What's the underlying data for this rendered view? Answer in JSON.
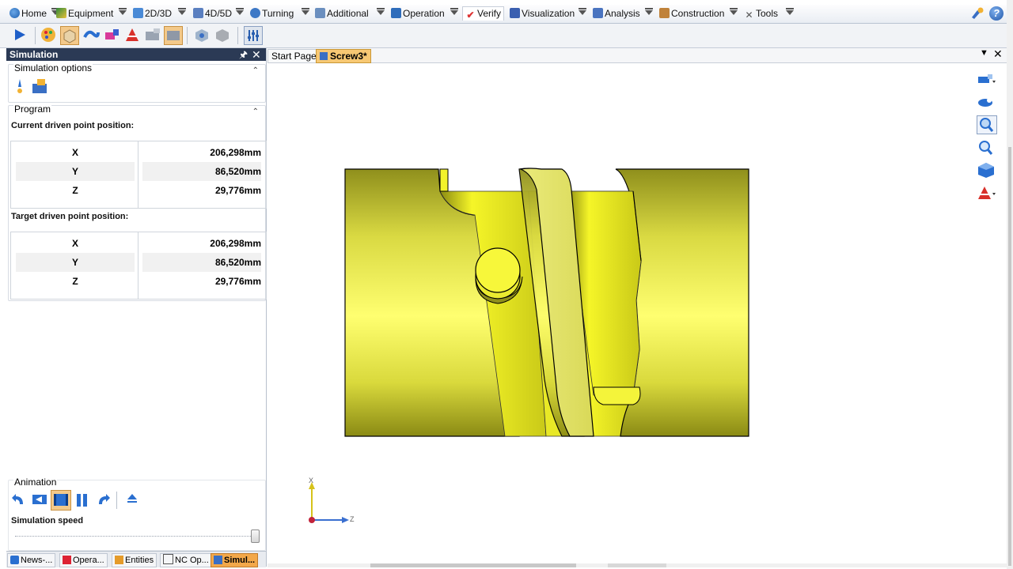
{
  "menu": {
    "items": [
      {
        "label": "Home",
        "icon": "home-icon"
      },
      {
        "label": "Equipment",
        "icon": "equipment-icon"
      },
      {
        "label": "2D/3D",
        "icon": "2d3d-icon"
      },
      {
        "label": "4D/5D",
        "icon": "4d5d-icon"
      },
      {
        "label": "Turning",
        "icon": "turning-icon"
      },
      {
        "label": "Additional",
        "icon": "additional-icon"
      },
      {
        "label": "Operation",
        "icon": "operation-icon"
      },
      {
        "label": "Verify",
        "icon": "verify-icon",
        "active": true
      },
      {
        "label": "Visualization",
        "icon": "visualization-icon"
      },
      {
        "label": "Analysis",
        "icon": "analysis-icon"
      },
      {
        "label": "Construction",
        "icon": "construction-icon"
      },
      {
        "label": "Tools",
        "icon": "tools-icon"
      }
    ]
  },
  "panel": {
    "title": "Simulation",
    "pin_icon": "pin-icon",
    "close_icon": "close-icon",
    "sim_options_title": "Simulation options",
    "program_title": "Program",
    "current_label": "Current driven point position:",
    "target_label": "Target driven point position:",
    "current": [
      {
        "axis": "X",
        "value": "206,298mm"
      },
      {
        "axis": "Y",
        "value": "86,520mm"
      },
      {
        "axis": "Z",
        "value": "29,776mm"
      }
    ],
    "target": [
      {
        "axis": "X",
        "value": "206,298mm"
      },
      {
        "axis": "Y",
        "value": "86,520mm"
      },
      {
        "axis": "Z",
        "value": "29,776mm"
      }
    ],
    "animation_title": "Animation",
    "speed_label": "Simulation speed",
    "speed_level": 1.0
  },
  "bottom_tabs": [
    {
      "label": "News-..."
    },
    {
      "label": "Opera..."
    },
    {
      "label": "Entities"
    },
    {
      "label": "NC Op..."
    },
    {
      "label": "Simul...",
      "selected": true
    }
  ],
  "doc_tabs": [
    {
      "label": "Start Page"
    },
    {
      "label": "Screw3*",
      "selected": true
    }
  ],
  "axes": {
    "vertical": "X",
    "horizontal": "Z"
  },
  "colors": {
    "part": "#e8e84a",
    "panel_header": "#2b3a55",
    "active_tab": "#f7c873"
  }
}
